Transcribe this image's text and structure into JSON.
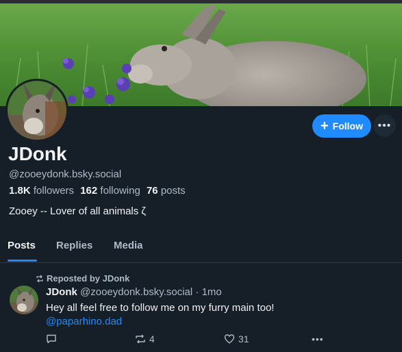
{
  "profile": {
    "display_name": "JDonk",
    "handle": "@zooeydonk.bsky.social",
    "followers_count": "1.8K",
    "followers_label": "followers",
    "following_count": "162",
    "following_label": "following",
    "posts_count": "76",
    "posts_label": "posts",
    "bio": "Zooey -- Lover of all animals ζ",
    "follow_label": "Follow",
    "more_label": "•••"
  },
  "tabs": [
    {
      "label": "Posts",
      "active": true
    },
    {
      "label": "Replies",
      "active": false
    },
    {
      "label": "Media",
      "active": false
    }
  ],
  "feed": [
    {
      "repost_label": "Reposted by JDonk",
      "author_name": "JDonk",
      "author_handle": "@zooeydonk.bsky.social",
      "separator": "·",
      "time": "1mo",
      "text": "Hey all feel free to follow me on my furry main too!",
      "link": "@paparhino.dad",
      "reposts": "4",
      "likes": "31",
      "more_label": "•••"
    }
  ],
  "colors": {
    "background": "#161e27",
    "accent": "#208bfe",
    "text_primary": "#f1f3f5",
    "text_secondary": "#aebbc9"
  }
}
